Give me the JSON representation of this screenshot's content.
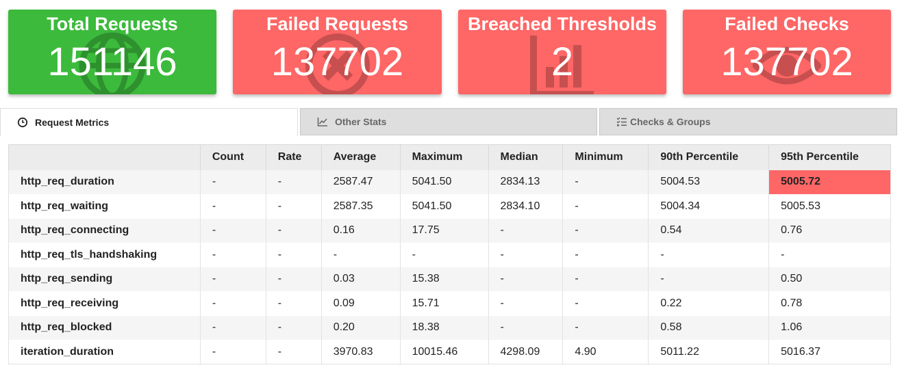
{
  "cards": [
    {
      "title": "Total Requests",
      "value": "151146",
      "color": "#3cba3c",
      "icon": "globe-icon"
    },
    {
      "title": "Failed Requests",
      "value": "137702",
      "color": "#ff6666",
      "icon": "times-circle-icon"
    },
    {
      "title": "Breached Thresholds",
      "value": "2",
      "color": "#ff6666",
      "icon": "chart-bar-icon"
    },
    {
      "title": "Failed Checks",
      "value": "137702",
      "color": "#ff6666",
      "icon": "eye-icon"
    }
  ],
  "tabs": [
    {
      "label": "Request Metrics",
      "icon": "clock-icon",
      "active": true
    },
    {
      "label": "Other Stats",
      "icon": "chart-line-icon",
      "active": false
    },
    {
      "label": "Checks & Groups",
      "icon": "tasks-icon",
      "active": false
    }
  ],
  "table": {
    "headers": [
      "",
      "Count",
      "Rate",
      "Average",
      "Maximum",
      "Median",
      "Minimum",
      "90th Percentile",
      "95th Percentile"
    ],
    "rows": [
      [
        "http_req_duration",
        "-",
        "-",
        "2587.47",
        "5041.50",
        "2834.13",
        "-",
        "5004.53",
        "5005.72"
      ],
      [
        "http_req_waiting",
        "-",
        "-",
        "2587.35",
        "5041.50",
        "2834.10",
        "-",
        "5004.34",
        "5005.53"
      ],
      [
        "http_req_connecting",
        "-",
        "-",
        "0.16",
        "17.75",
        "-",
        "-",
        "0.54",
        "0.76"
      ],
      [
        "http_req_tls_handshaking",
        "-",
        "-",
        "-",
        "-",
        "-",
        "-",
        "-",
        "-"
      ],
      [
        "http_req_sending",
        "-",
        "-",
        "0.03",
        "15.38",
        "-",
        "-",
        "-",
        "0.50"
      ],
      [
        "http_req_receiving",
        "-",
        "-",
        "0.09",
        "15.71",
        "-",
        "-",
        "0.22",
        "0.78"
      ],
      [
        "http_req_blocked",
        "-",
        "-",
        "0.20",
        "18.38",
        "-",
        "-",
        "0.58",
        "1.06"
      ],
      [
        "iteration_duration",
        "-",
        "-",
        "3970.83",
        "10015.46",
        "4298.09",
        "4.90",
        "5011.22",
        "5016.37"
      ]
    ],
    "breached_cell": {
      "row": 0,
      "col": 8,
      "color": "#ff6666"
    }
  }
}
